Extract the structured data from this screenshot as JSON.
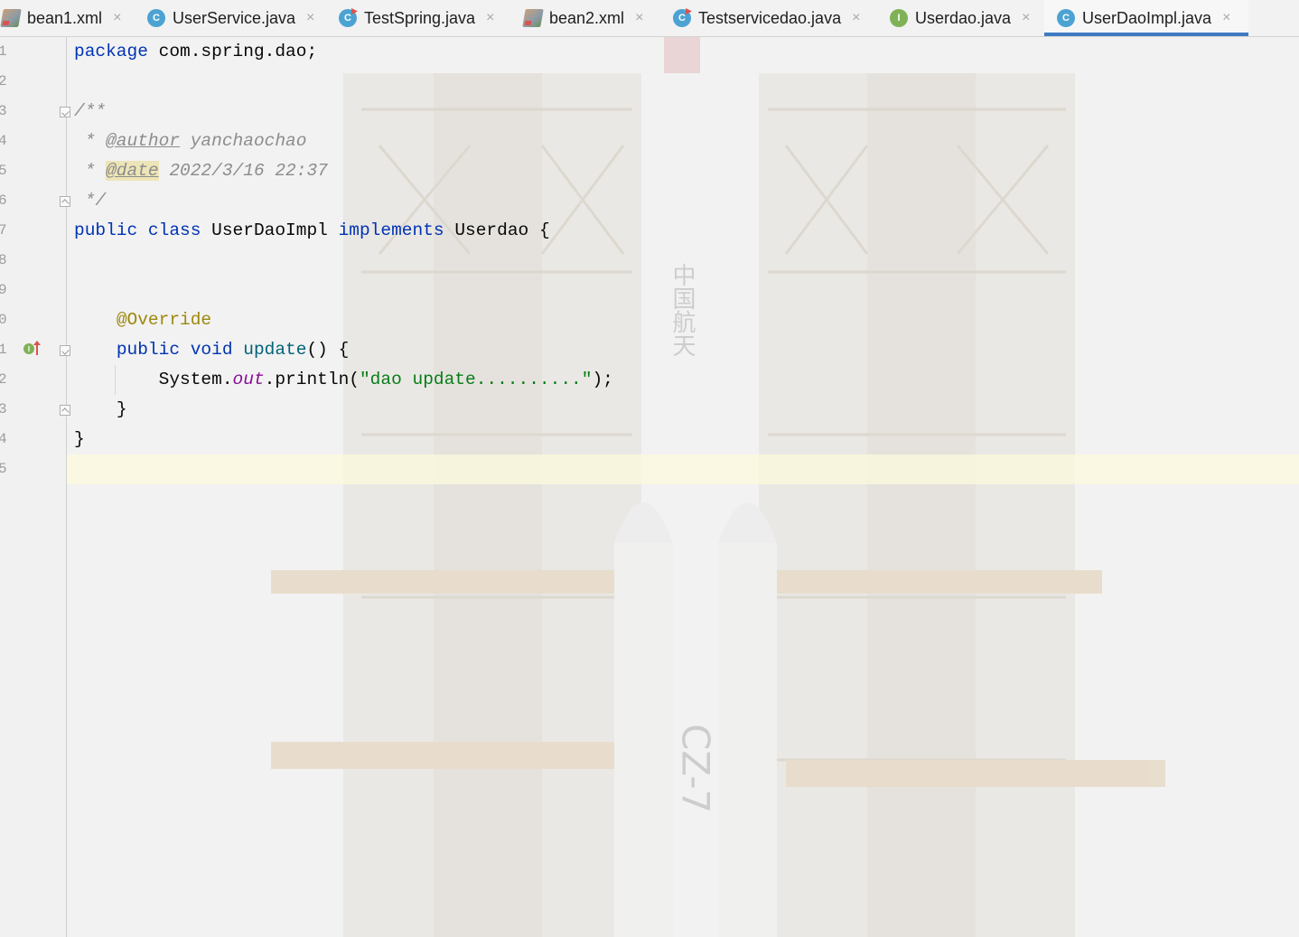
{
  "tabs": [
    {
      "label": "bean1.xml",
      "icon": "xml-file-icon",
      "active": false
    },
    {
      "label": "UserService.java",
      "icon": "java-class-icon",
      "active": false
    },
    {
      "label": "TestSpring.java",
      "icon": "java-class-run-icon",
      "active": false
    },
    {
      "label": "bean2.xml",
      "icon": "xml-file-icon",
      "active": false
    },
    {
      "label": "Testservicedao.java",
      "icon": "java-class-run-icon",
      "active": false
    },
    {
      "label": "Userdao.java",
      "icon": "java-interface-icon",
      "active": false
    },
    {
      "label": "UserDaoImpl.java",
      "icon": "java-class-icon",
      "active": true
    }
  ],
  "tab_close_glyph": "×",
  "class_icon_letter": "C",
  "interface_icon_letter": "I",
  "line_numbers": [
    "1",
    "2",
    "3",
    "4",
    "5",
    "6",
    "7",
    "8",
    "9",
    "0",
    "1",
    "2",
    "3",
    "4",
    "5"
  ],
  "code": {
    "l1_kw": "package",
    "l1_rest": " com.spring.dao;",
    "l3_text": "/**",
    "l4_star": " * ",
    "l4_tag": "@author",
    "l4_text": " yanchaochao",
    "l5_star": " * ",
    "l5_tag": "@date",
    "l5_text": " 2022/3/16 22:37",
    "l6_text": " */",
    "l7_kw1": "public",
    "l7_kw2": "class",
    "l7_name": "UserDaoImpl",
    "l7_kw3": "implements",
    "l7_iface": "Userdao",
    "l7_brace": "{",
    "l10_anno": "@Override",
    "l11_kw1": "public",
    "l11_kw2": "void",
    "l11_fn": "update",
    "l11_rest": "() {",
    "l12_obj": "System.",
    "l12_fld": "out",
    "l12_call": ".println(",
    "l12_str": "\"dao update..........\"",
    "l12_end": ");",
    "l13_text": "}",
    "l14_text": "}"
  },
  "colors": {
    "keyword": "#0033b3",
    "comment": "#8c8c8c",
    "annotation": "#9e880d",
    "method": "#00627a",
    "static_field": "#871094",
    "string": "#067d17",
    "active_tab_underline": "#3f7bc4"
  },
  "background_image": {
    "text_vertical": "中国航天",
    "rocket_label": "CZ-7"
  }
}
